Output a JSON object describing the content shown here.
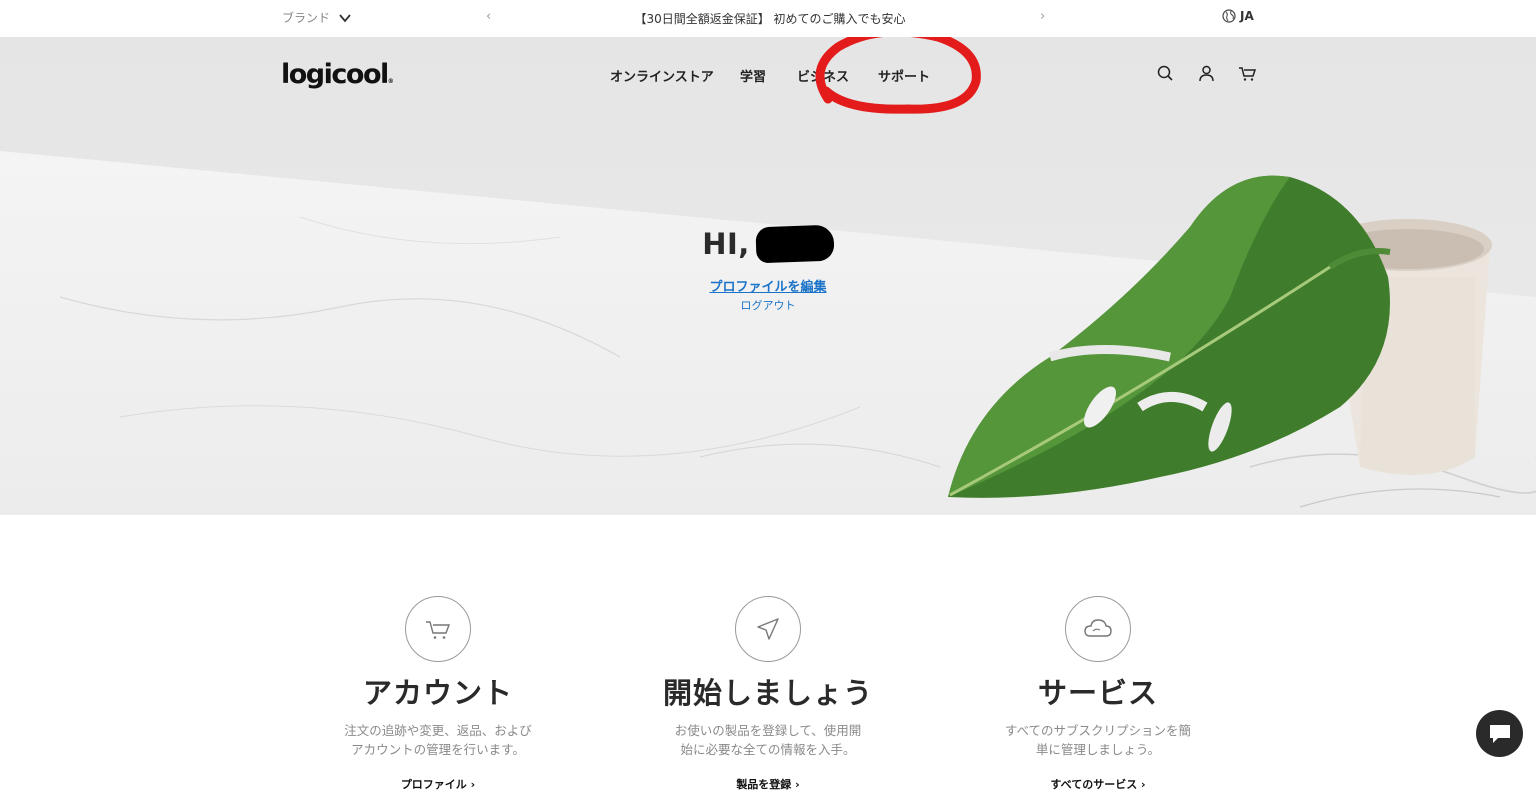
{
  "topbar": {
    "brand_label": "ブランド",
    "promo_text": "【30日間全額返金保証】 初めてのご購入でも安心",
    "prev_glyph": "‹",
    "next_glyph": "›",
    "language": "JA"
  },
  "nav": {
    "logo": "logicool",
    "logo_mark": "®",
    "items": [
      {
        "label": "オンラインストア"
      },
      {
        "label": "学習"
      },
      {
        "label": "ビジネス"
      },
      {
        "label": "サポート"
      }
    ],
    "icons": [
      "search-icon",
      "account-icon",
      "cart-icon"
    ]
  },
  "annotation": {
    "color": "#e31b1b",
    "target": "サポート"
  },
  "hero": {
    "greeting": "HI,",
    "edit_profile": "プロファイルを編集",
    "logout": "ログアウト"
  },
  "cards": [
    {
      "icon": "cart-icon",
      "title": "アカウント",
      "desc_line1": "注文の追跡や変更、返品、および",
      "desc_line2": "アカウントの管理を行います。",
      "cta": "プロファイル ›"
    },
    {
      "icon": "navigation-arrow-icon",
      "title": "開始しましょう",
      "desc_line1": "お使いの製品を登録して、使用開",
      "desc_line2": "始に必要な全ての情報を入手。",
      "cta": "製品を登録 ›"
    },
    {
      "icon": "cloud-icon",
      "title": "サービス",
      "desc_line1": "すべてのサブスクリプションを簡",
      "desc_line2": "単に管理しましょう。",
      "cta": "すべてのサービス ›"
    }
  ],
  "colors": {
    "link": "#1a73c8",
    "accent_red": "#e31b1b",
    "chat_bg": "#2a2a2a"
  }
}
